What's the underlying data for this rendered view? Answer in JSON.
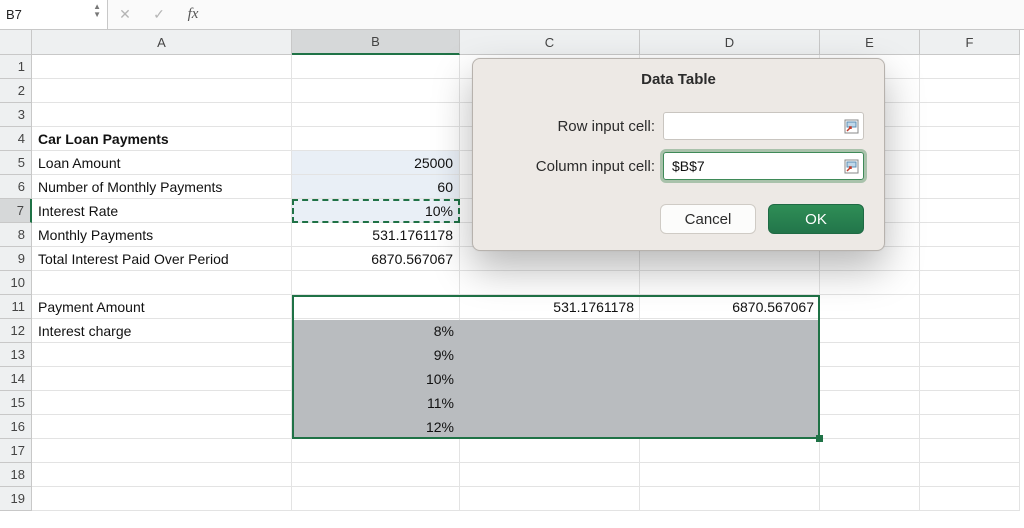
{
  "namebox": {
    "value": "B7"
  },
  "fx": {
    "cancel_glyph": "✕",
    "accept_glyph": "✓",
    "fx_label": "fx"
  },
  "columns": [
    "A",
    "B",
    "C",
    "D",
    "E",
    "F"
  ],
  "rows": [
    "1",
    "2",
    "3",
    "4",
    "5",
    "6",
    "7",
    "8",
    "9",
    "10",
    "11",
    "12",
    "13",
    "14",
    "15",
    "16",
    "17",
    "18",
    "19"
  ],
  "active": {
    "row": 7,
    "col": "B"
  },
  "sheet": {
    "a4": "Car Loan Payments",
    "a5": "Loan Amount",
    "b5": "25000",
    "a6": "Number of Monthly Payments",
    "b6": "60",
    "a7": "Interest Rate",
    "b7": "10%",
    "a8": "Monthly Payments",
    "b8": "531.1761178",
    "a9": "Total Interest Paid Over Period",
    "b9": "6870.567067",
    "a11": "Payment Amount",
    "c11": "531.1761178",
    "d11": "6870.567067",
    "a12": "Interest charge",
    "b12": "8%",
    "b13": "9%",
    "b14": "10%",
    "b15": "11%",
    "b16": "12%"
  },
  "dialog": {
    "title": "Data Table",
    "row_label": "Row input cell:",
    "col_label": "Column input cell:",
    "row_value": "",
    "col_value": "$B$7",
    "cancel": "Cancel",
    "ok": "OK"
  },
  "chart_data": {
    "type": "table",
    "title": "Car Loan Payments — Data Table setup",
    "inputs": {
      "loan_amount": 25000,
      "number_of_monthly_payments": 60,
      "interest_rate": 0.1
    },
    "computed": {
      "monthly_payment": 531.1761178,
      "total_interest_paid_over_period": 6870.567067
    },
    "data_table": {
      "column_input_cell": "$B$7",
      "row_input_cell": "",
      "output_headers": [
        "Payment Amount",
        "Total Interest"
      ],
      "header_values": [
        531.1761178,
        6870.567067
      ],
      "interest_rates": [
        0.08,
        0.09,
        0.1,
        0.11,
        0.12
      ]
    }
  }
}
